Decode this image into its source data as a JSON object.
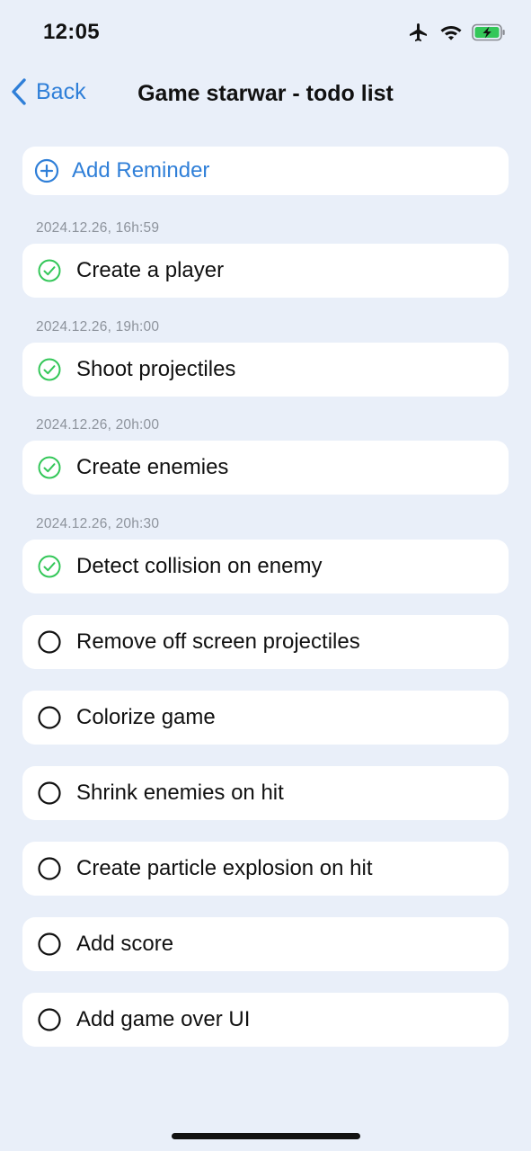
{
  "status_bar": {
    "time": "12:05"
  },
  "nav": {
    "back_label": "Back",
    "title": "Game starwar - todo list"
  },
  "add_reminder": {
    "label": "Add Reminder"
  },
  "timestamps": [
    "2024.12.26, 16h:59",
    "2024.12.26, 19h:00",
    "2024.12.26, 20h:00",
    "2024.12.26, 20h:30"
  ],
  "items": [
    {
      "label": "Create a player",
      "completed": true
    },
    {
      "label": "Shoot projectiles",
      "completed": true
    },
    {
      "label": "Create enemies",
      "completed": true
    },
    {
      "label": "Detect collision on enemy",
      "completed": true
    },
    {
      "label": "Remove off screen projectiles",
      "completed": false
    },
    {
      "label": "Colorize game",
      "completed": false
    },
    {
      "label": "Shrink enemies on hit",
      "completed": false
    },
    {
      "label": "Create particle explosion on hit",
      "completed": false
    },
    {
      "label": "Add score",
      "completed": false
    },
    {
      "label": "Add game over UI",
      "completed": false
    }
  ],
  "colors": {
    "background": "#e9eff9",
    "accent": "#2f7fd8",
    "completed": "#34c759",
    "battery": "#34c759"
  },
  "icons": {
    "status": [
      "airplane-icon",
      "wifi-icon",
      "battery-charging-icon"
    ],
    "back": "chevron-left-icon",
    "add": "plus-circle-icon",
    "completed": "check-circle-icon",
    "pending": "empty-circle-icon"
  }
}
